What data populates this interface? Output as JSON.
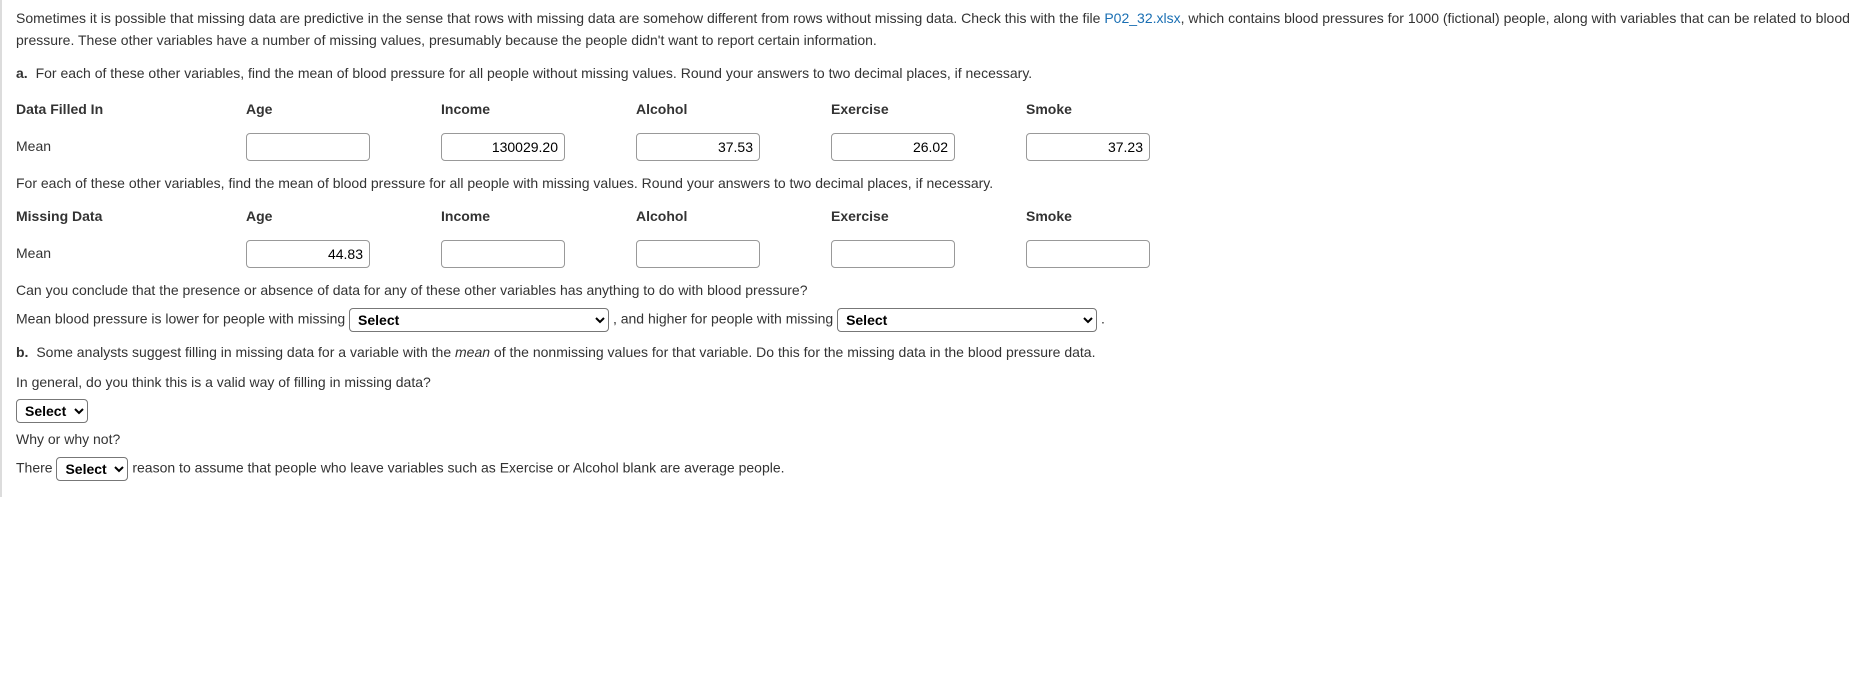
{
  "intro": {
    "part1": "Sometimes it is possible that missing data are predictive in the sense that rows with missing data are somehow different from rows without missing data. Check this with the file ",
    "file": "P02_32.xlsx",
    "part2": ", which contains blood pressures for 1000 (fictional) people, along with variables that can be related to blood pressure. These other variables have a number of missing values, presumably because the people didn't want to report certain information."
  },
  "partA": {
    "letter": "a.",
    "prompt1": "For each of these other variables, find the mean of blood pressure for all people without missing values. Round your answers to two decimal places, if necessary.",
    "table1": {
      "rowHeader": "Data Filled In",
      "meanLabel": "Mean",
      "cols": [
        "Age",
        "Income",
        "Alcohol",
        "Exercise",
        "Smoke"
      ],
      "values": [
        "",
        "130029.20",
        "37.53",
        "26.02",
        "37.23"
      ]
    },
    "prompt2": "For each of these other variables, find the mean of blood pressure for all people with missing values. Round your answers to two decimal places, if necessary.",
    "table2": {
      "rowHeader": "Missing Data",
      "meanLabel": "Mean",
      "cols": [
        "Age",
        "Income",
        "Alcohol",
        "Exercise",
        "Smoke"
      ],
      "values": [
        "44.83",
        "",
        "",
        "",
        ""
      ]
    },
    "concludeQ": "Can you conclude that the presence or absence of data for any of these other variables has anything to do with blood pressure?",
    "sentence": {
      "p1": "Mean blood pressure is lower for people with missing ",
      "select1": "Select",
      "p2": " , and higher for people with missing ",
      "select2": "Select",
      "p3": " ."
    }
  },
  "partB": {
    "letter": "b.",
    "prompt_p1": "Some analysts suggest filling in missing data for a variable with the ",
    "prompt_mean": "mean",
    "prompt_p2": " of the nonmissing values for that variable. Do this for the missing data in the blood pressure data.",
    "validQ": "In general, do you think this is a valid way of filling in missing data?",
    "select1": "Select",
    "whyQ": "Why or why not?",
    "sentence": {
      "p1": "There ",
      "select": "Select",
      "p2": " reason to assume that people who leave variables such as Exercise or Alcohol blank are average people."
    }
  }
}
